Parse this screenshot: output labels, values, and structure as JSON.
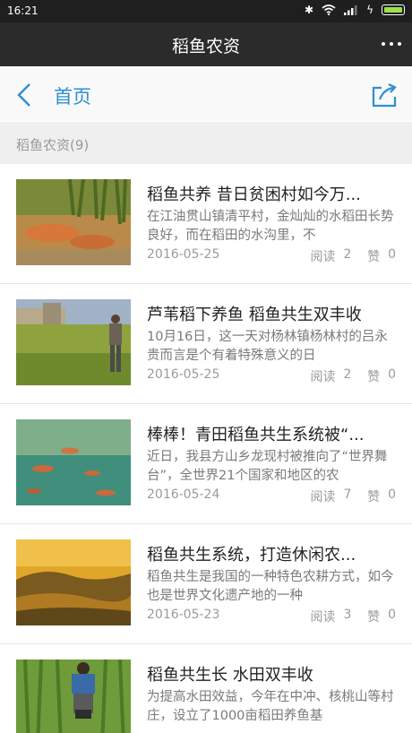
{
  "status_bar": {
    "time": "16:21",
    "icons": [
      "bluetooth-icon",
      "wifi-icon",
      "signal-icon",
      "charging-icon",
      "battery-icon"
    ]
  },
  "title_bar": {
    "title": "稻鱼农资",
    "more_icon": "more-icon"
  },
  "nav_bar": {
    "back_icon": "chevron-left-icon",
    "title": "首页",
    "share_icon": "share-icon"
  },
  "section": {
    "title": "稻鱼农资(9)"
  },
  "labels": {
    "read": "阅读",
    "like": "赞"
  },
  "articles": [
    {
      "title": "稻鱼共养 昔日贫困村如今万...",
      "summary": "在江油贯山镇清平村，金灿灿的水稻田长势良好，而在稻田的水沟里，不",
      "date": "2016-05-25",
      "reads": "2",
      "likes": "0"
    },
    {
      "title": "芦苇稻下养鱼 稻鱼共生双丰收",
      "summary": "10月16日，这一天对杨林镇杨林村的吕永贵而言是个有着特殊意义的日",
      "date": "2016-05-25",
      "reads": "2",
      "likes": "0"
    },
    {
      "title": "棒棒！青田稻鱼共生系统被“...",
      "summary": "近日，我县方山乡龙现村被推向了“世界舞台”，全世界21个国家和地区的农",
      "date": "2016-05-24",
      "reads": "7",
      "likes": "0"
    },
    {
      "title": "稻鱼共生系统，打造休闲农...",
      "summary": "稻鱼共生是我国的一种特色农耕方式，如今也是世界文化遗产地的一种",
      "date": "2016-05-23",
      "reads": "3",
      "likes": "0"
    },
    {
      "title": "稻鱼共生长 水田双丰收",
      "summary": "为提高水田效益，今年在中冲、核桃山等村庄，设立了1000亩稻田养鱼基",
      "date": "",
      "reads": "",
      "likes": ""
    }
  ]
}
